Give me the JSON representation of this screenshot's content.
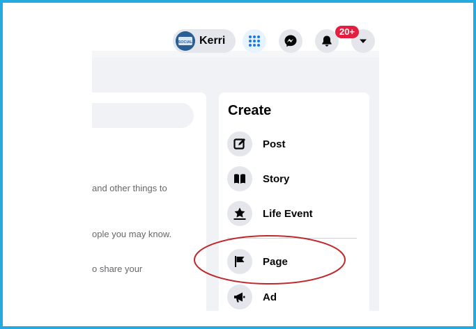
{
  "header": {
    "profile_name": "Kerri",
    "avatar_text": "SOCIAL",
    "notifications_badge": "20+"
  },
  "left_panel": {
    "hints": [
      "and other things to",
      "ople you may know.",
      "o share your"
    ]
  },
  "create_menu": {
    "title": "Create",
    "items": [
      {
        "label": "Post",
        "icon": "compose-icon"
      },
      {
        "label": "Story",
        "icon": "book-icon"
      },
      {
        "label": "Life Event",
        "icon": "star-icon"
      },
      {
        "label": "Page",
        "icon": "flag-icon",
        "highlighted": true
      },
      {
        "label": "Ad",
        "icon": "megaphone-icon"
      }
    ]
  },
  "colors": {
    "frame_border": "#24a9e1",
    "highlight_ring": "#c0282a",
    "badge": "#e41e3f",
    "menu_icon_active": "#1877f2"
  }
}
